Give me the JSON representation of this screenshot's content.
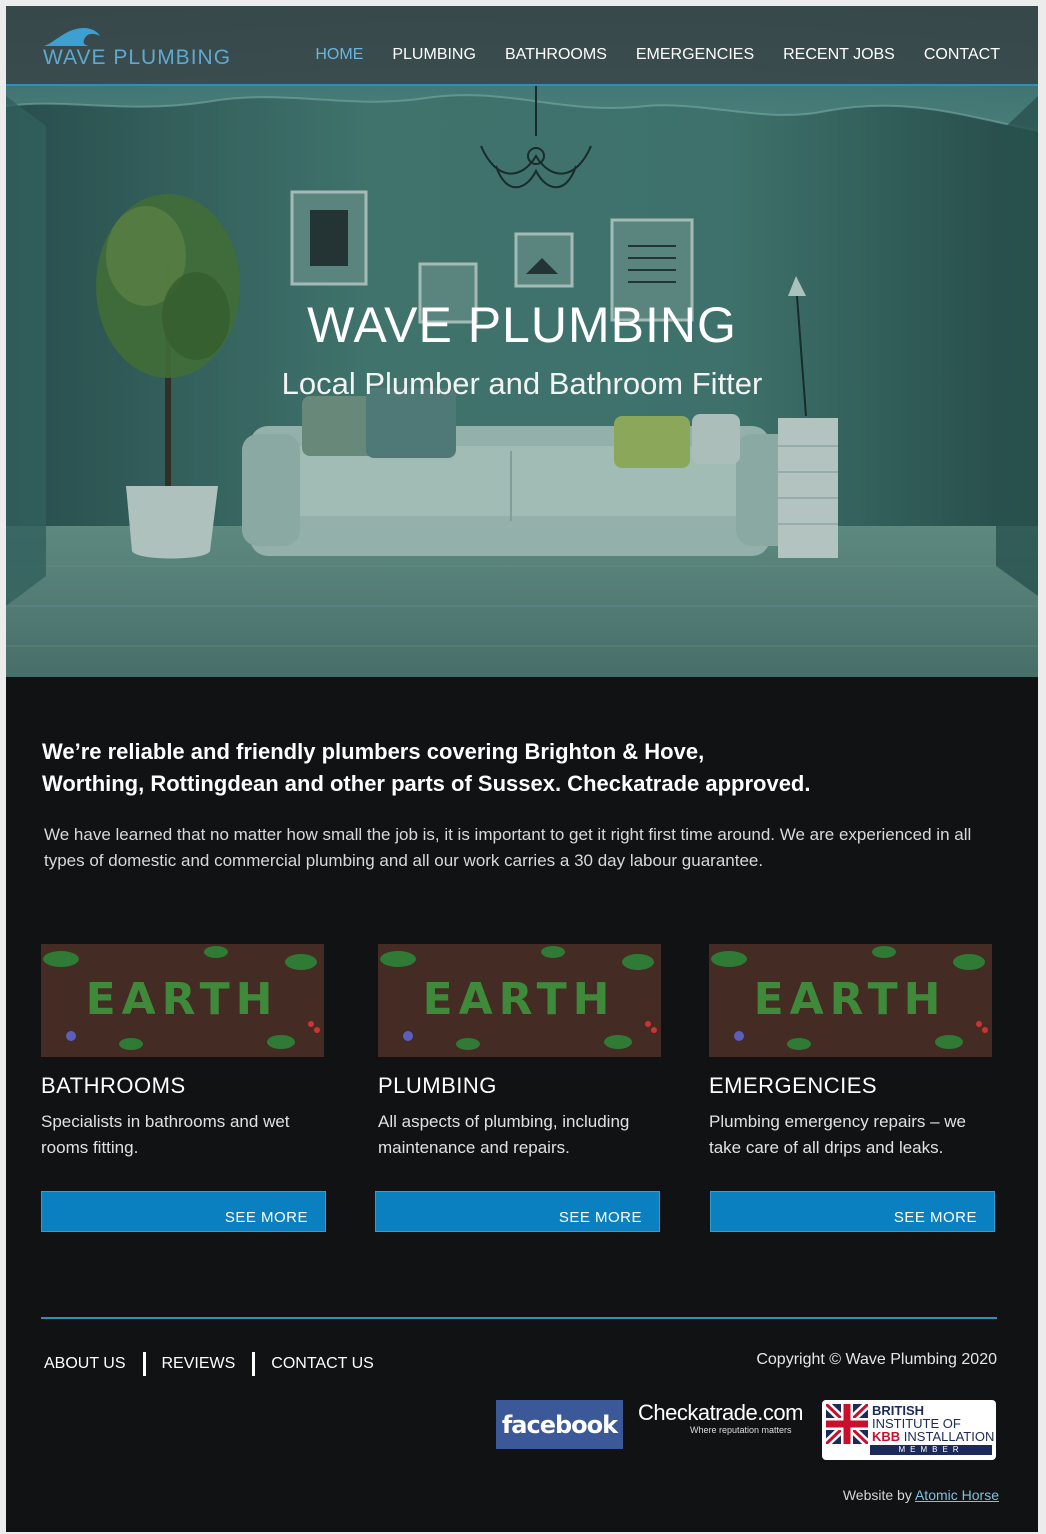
{
  "brand": {
    "logo_text": "WAVE PLUMBING",
    "accent_color": "#0a80c0",
    "link_color": "#69b6dd"
  },
  "nav": {
    "items": [
      {
        "label": "HOME",
        "active": true
      },
      {
        "label": "PLUMBING",
        "active": false
      },
      {
        "label": "BATHROOMS",
        "active": false
      },
      {
        "label": "EMERGENCIES",
        "active": false
      },
      {
        "label": "RECENT JOBS",
        "active": false
      },
      {
        "label": "CONTACT",
        "active": false
      }
    ]
  },
  "hero": {
    "title": "WAVE PLUMBING",
    "subtitle": "Local Plumber and Bathroom Fitter"
  },
  "intro": {
    "heading_line1": "We’re reliable and friendly plumbers covering Brighton & Hove,",
    "heading_line2": "Worthing, Rottingdean and other parts of Sussex. Checkatrade approved.",
    "body": "We have learned that no matter how small the job is, it is important to get it right first time around. We are experienced in all types of domestic and commercial plumbing and all our work carries a 30 day labour guarantee."
  },
  "services": [
    {
      "title": "BATHROOMS",
      "text": "Specialists in bathrooms and wet rooms fitting.",
      "button": "SEE MORE",
      "image_word": "EARTH"
    },
    {
      "title": "PLUMBING",
      "text": "All aspects of plumbing, including maintenance and repairs.",
      "button": "SEE MORE",
      "image_word": "EARTH"
    },
    {
      "title": "EMERGENCIES",
      "text": "Plumbing emergency repairs – we take care of all drips and leaks.",
      "button": "SEE MORE",
      "image_word": "EARTH"
    }
  ],
  "footer": {
    "links": [
      "ABOUT US",
      "REVIEWS",
      "CONTACT US"
    ],
    "copyright": "Copyright © Wave Plumbing 2020",
    "badges": {
      "facebook": "facebook",
      "checkatrade": "Checkatrade.com",
      "checkatrade_tagline": "Where reputation matters",
      "kbb_line1": "BRITISH",
      "kbb_line2": "INSTITUTE OF",
      "kbb_kbb": "KBB",
      "kbb_line3": "INSTALLATION",
      "kbb_member": "MEMBER"
    },
    "credit_prefix": "Website by",
    "credit_link": "Atomic Horse"
  }
}
